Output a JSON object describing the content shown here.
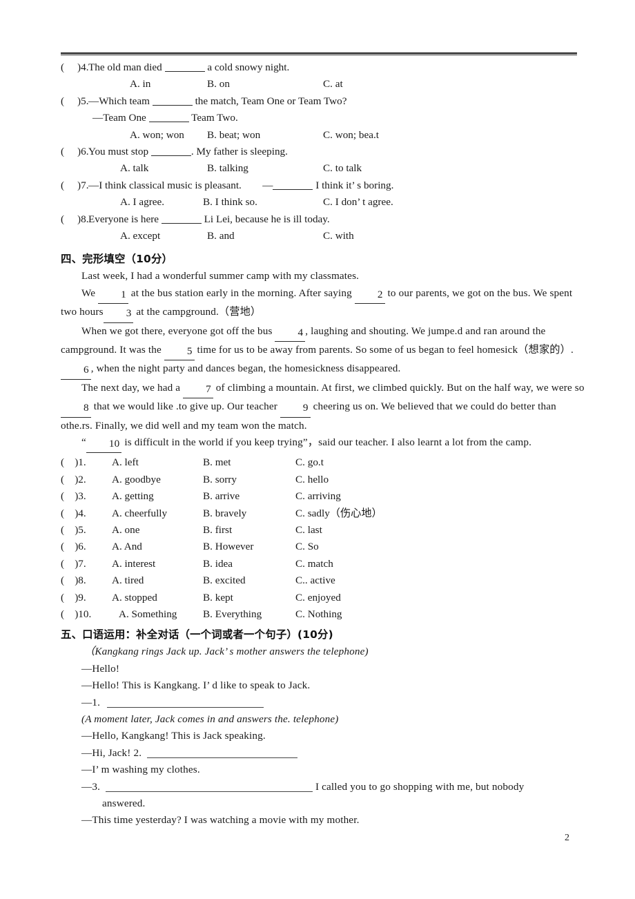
{
  "page": {
    "number": "2"
  },
  "grammar_section": {
    "questions": [
      {
        "marker": "(     )4.",
        "stem_before": "The old man died ",
        "stem_after": " a cold snowy night.",
        "options": [
          "A. in",
          "B. on",
          "C. at"
        ]
      },
      {
        "marker": "(     )5.",
        "stem_before": "—Which team ",
        "stem_after": " the match, Team One or Team Two?",
        "stem_line2_before": "—Team One ",
        "stem_line2_after": " Team Two.",
        "options": [
          "A. won; won",
          "B. beat; won",
          "C. won; bea.t"
        ]
      },
      {
        "marker": "(     )6.",
        "stem_before": "You must stop ",
        "stem_after": ". My father is sleeping.",
        "options": [
          "A. talk",
          "B. talking",
          "C. to talk"
        ]
      },
      {
        "marker": "(     )7.",
        "stem_before": "—I think classical music is pleasant.        —",
        "stem_after": " I think it’ s boring.",
        "options": [
          "A. I agree.",
          "B. I think so.",
          "C. I don’ t agree."
        ]
      },
      {
        "marker": "(     )8.",
        "stem_before": "Everyone is here ",
        "stem_after": " Li Lei, because he is ill today.",
        "options": [
          "A. except",
          "B. and",
          "C. with"
        ]
      }
    ]
  },
  "cloze_section": {
    "heading": "四、完形填空（10分）",
    "passage": [
      {
        "indent": true,
        "parts": [
          {
            "t": "text",
            "v": "Last week, I had a wonderful summer camp with my classmates."
          }
        ]
      },
      {
        "indent": true,
        "parts": [
          {
            "t": "text",
            "v": "We "
          },
          {
            "t": "blank",
            "v": "1"
          },
          {
            "t": "text",
            "v": " at the bus station early in the morning. After saying "
          },
          {
            "t": "blank",
            "v": "2"
          },
          {
            "t": "text",
            "v": " to our parents, we got on the bus. We spent two hours"
          },
          {
            "t": "blank",
            "v": "3"
          },
          {
            "t": "text",
            "v": " at the campground.（营地）"
          }
        ]
      },
      {
        "indent": true,
        "parts": [
          {
            "t": "text",
            "v": "When we got there, everyone got off the bus "
          },
          {
            "t": "blank",
            "v": "4"
          },
          {
            "t": "text",
            "v": ", laughing and shouting. We jumpe.d and ran around the campground. It was the "
          },
          {
            "t": "blank",
            "v": "5"
          },
          {
            "t": "text",
            "v": " time for us to be away from parents. So some of us began to feel homesick（想家的）. "
          },
          {
            "t": "blank",
            "v": "6"
          },
          {
            "t": "text",
            "v": ", when the night party and dances began, the homesickness disappeared."
          }
        ]
      },
      {
        "indent": true,
        "parts": [
          {
            "t": "text",
            "v": "The next day, we had a "
          },
          {
            "t": "blank",
            "v": "7"
          },
          {
            "t": "text",
            "v": " of climbing a mountain. At first, we climbed quickly. But on the half way, we were so "
          },
          {
            "t": "blank",
            "v": "8"
          },
          {
            "t": "text",
            "v": " that we would like .to give up. Our teacher "
          },
          {
            "t": "blank",
            "v": "9"
          },
          {
            "t": "text",
            "v": " cheering us on. We believed that we could do better than othe.rs. Finally, we did well and my team won the match."
          }
        ]
      },
      {
        "indent": true,
        "parts": [
          {
            "t": "text",
            "v": "“"
          },
          {
            "t": "blank",
            "v": "10"
          },
          {
            "t": "text",
            "v": " is difficult in the world if you keep trying”，said our teacher. I also learnt a lot from the camp."
          }
        ]
      }
    ],
    "options": [
      {
        "marker": "(    )1.",
        "a": "A. left",
        "b": "B. met",
        "c": "C. go.t"
      },
      {
        "marker": "(    )2.",
        "a": "A. goodbye",
        "b": "B. sorry",
        "c": "C. hello"
      },
      {
        "marker": "(    )3.",
        "a": "A. getting",
        "b": "B. arrive",
        "c": "C. arriving"
      },
      {
        "marker": "(    )4.",
        "a": "A. cheerfully",
        "b": "B. bravely",
        "c": "C. sadly（伤心地）"
      },
      {
        "marker": "(    )5.",
        "a": "A. one",
        "b": "B. first",
        "c": "C. last"
      },
      {
        "marker": "(    )6.",
        "a": "A. And",
        "b": "B. However",
        "c": "C. So"
      },
      {
        "marker": "(    )7.",
        "a": "A. interest",
        "b": "B. idea",
        "c": "C. match"
      },
      {
        "marker": "(    )8.",
        "a": "A. tired",
        "b": "B. excited",
        "c": "C.. active"
      },
      {
        "marker": "(    )9.",
        "a": "A. stopped",
        "b": "B. kept",
        "c": "C. enjoyed"
      },
      {
        "marker": "(    )10.",
        "a": "A. Something",
        "b": "B. Everything",
        "c": "C. Nothing"
      }
    ]
  },
  "dialogue_section": {
    "heading": "五、口语运用：补全对话（一个词或者一个句子）(10分)",
    "stage_1": "（Kangkang rings Jack up. Jack’ s mother answers the telephone)",
    "lines_1": [
      "—Hello!",
      "—Hello! This is Kangkang. I’ d like to speak to Jack."
    ],
    "blank_1_label": "—1.",
    "stage_2": "(A moment later, Jack comes in and answers the. telephone)",
    "lines_2": [
      "—Hello, Kangkang! This is Jack speaking."
    ],
    "blank_2_label": "—Hi, Jack! 2.",
    "lines_3": [
      "—I’ m washing my clothes."
    ],
    "blank_3_label": "—3.",
    "blank_3_after": " I called you to go shopping with me, but nobody",
    "blank_3_cont": "answered.",
    "lines_4": [
      "—This time yesterday? I was watching a movie with my mother."
    ]
  }
}
